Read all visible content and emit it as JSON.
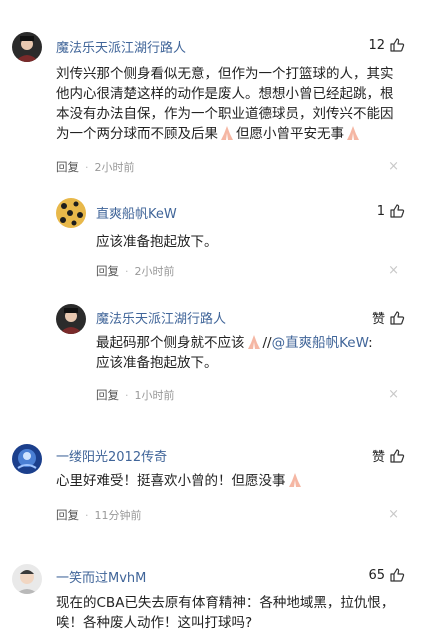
{
  "comments": [
    {
      "user": "魔法乐天派江湖行路人",
      "likes": "12",
      "text_1": "刘传兴那个侧身看似无意，但作为一个打篮球的人，其实",
      "text_2": "他内心很清楚这样的动作是废人。想想小曾已经起跳，根",
      "text_3": "本没有办法自保，作为一个职业道德球员，刘传兴不能因",
      "text_4a": "为一个两分球而不顾及后果",
      "text_4b": "但愿小曾平安无事",
      "reply": "回复",
      "time": "2小时前"
    },
    {
      "user": "直爽船帆KeW",
      "likes": "1",
      "text": "应该准备抱起放下。",
      "reply": "回复",
      "time": "2小时前"
    },
    {
      "user": "魔法乐天派江湖行路人",
      "likes": "赞",
      "text_1a": "最起码那个侧身就不应该",
      "text_1b": "//",
      "mention": "@直爽船帆KeW",
      "text_1c": ":",
      "text_2": "应该准备抱起放下。",
      "reply": "回复",
      "time": "1小时前"
    },
    {
      "user": "一缕阳光2012传奇",
      "likes": "赞",
      "text": "心里好难受！挺喜欢小曾的！但愿没事",
      "reply": "回复",
      "time": "11分钟前"
    },
    {
      "user": "一笑而过MvhM",
      "likes": "65",
      "text_1": "现在的CBA已失去原有体育精神：各种地域黑，拉仇恨，",
      "text_2": "唉！各种废人动作！这叫打球吗?"
    }
  ],
  "colors": {
    "username": "#406599",
    "meta": "#999999",
    "text": "#222222"
  }
}
